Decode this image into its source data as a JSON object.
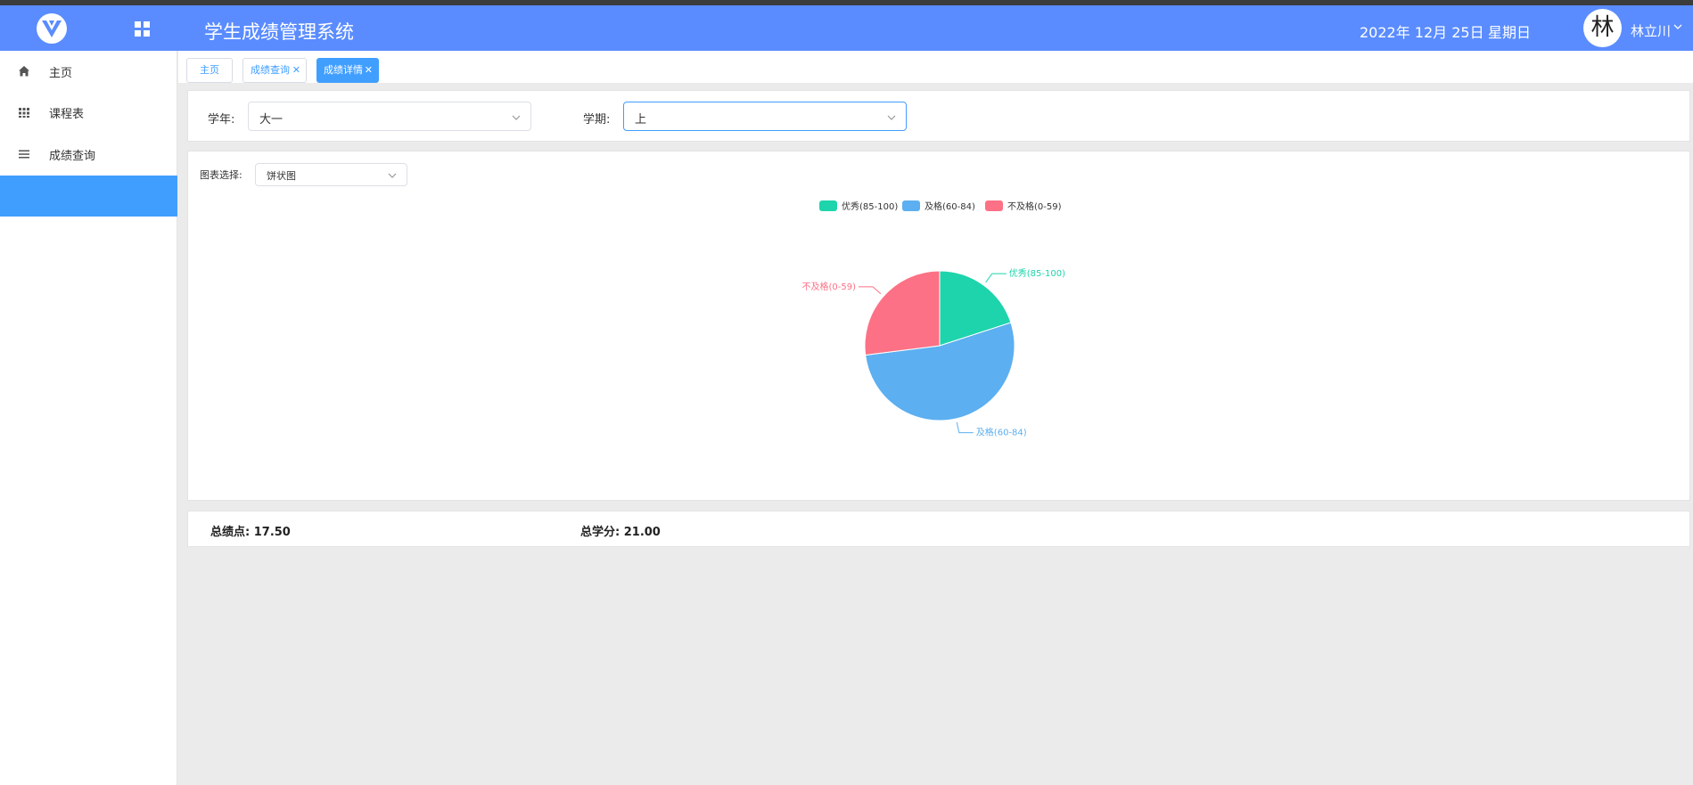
{
  "header": {
    "app_title": "学生成绩管理系统",
    "date": "2022年 12月 25日",
    "weekday": "星期日",
    "avatar_char": "林",
    "username": "林立川"
  },
  "sidebar": {
    "items": [
      {
        "label": "主页",
        "icon": "home-icon"
      },
      {
        "label": "课程表",
        "icon": "grid-icon"
      },
      {
        "label": "成绩查询",
        "icon": "list-icon"
      }
    ]
  },
  "tabs": [
    {
      "label": "主页",
      "closable": false,
      "active": false
    },
    {
      "label": "成绩查询",
      "closable": true,
      "active": false
    },
    {
      "label": "成绩详情",
      "closable": true,
      "active": true
    }
  ],
  "filters": {
    "year_label": "学年:",
    "year_value": "大一",
    "term_label": "学期:",
    "term_value": "上"
  },
  "chart_select": {
    "label": "图表选择:",
    "value": "饼状图"
  },
  "chart_data": {
    "type": "pie",
    "legend_position": "top-center",
    "slices": [
      {
        "name": "优秀(85-100)",
        "value": 20,
        "color": "#1ed4ac"
      },
      {
        "name": "及格(60-84)",
        "value": 53,
        "color": "#5caff0"
      },
      {
        "name": "不及格(0-59)",
        "value": 27,
        "color": "#fc7185"
      }
    ]
  },
  "summary": {
    "gpa_label": "总绩点: 17.50",
    "credit_label": "总学分: 21.00"
  },
  "colors": {
    "header": "#5a8cff",
    "accent": "#409eff",
    "background": "#ebebeb"
  }
}
